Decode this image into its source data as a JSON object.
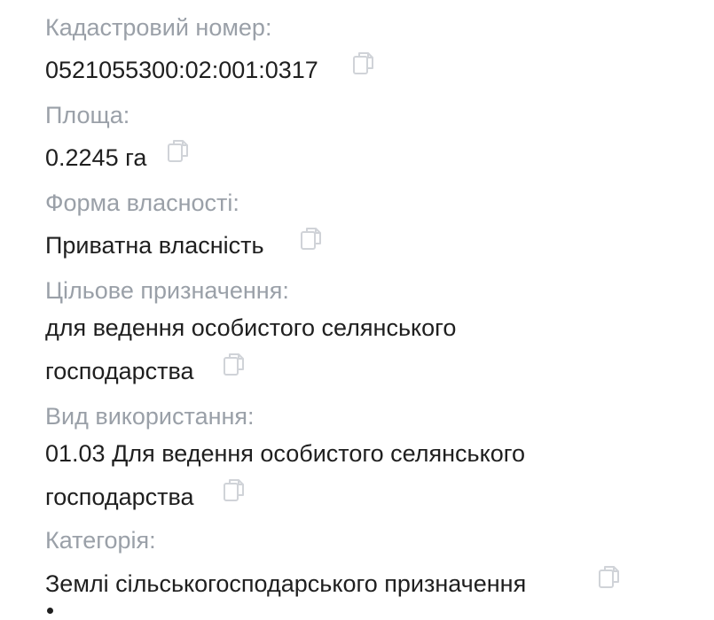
{
  "fields": {
    "cadastral": {
      "label": "Кадастровий номер:",
      "value": "0521055300:02:001:0317",
      "copy_icon": "copy-icon"
    },
    "area": {
      "label": "Площа:",
      "value": "0.2245 га",
      "copy_icon": "copy-icon"
    },
    "ownership": {
      "label": "Форма власності:",
      "value": "Приватна власність",
      "copy_icon": "copy-icon"
    },
    "purpose": {
      "label": "Цільове призначення:",
      "value_line1": "для ведення особистого селянського",
      "value_line2": "господарства",
      "copy_icon": "copy-icon"
    },
    "usage": {
      "label": "Вид використання:",
      "value_line1": "01.03 Для ведення особистого селянського",
      "value_line2": "господарства",
      "copy_icon": "copy-icon"
    },
    "category": {
      "label": "Категорія:",
      "value": "Землі сільськогосподарського призначення",
      "copy_icon": "copy-icon"
    }
  },
  "colors": {
    "label": "#9aa0a8",
    "value": "#1f1f1f",
    "icon": "#d0d3d8",
    "background": "#ffffff"
  }
}
